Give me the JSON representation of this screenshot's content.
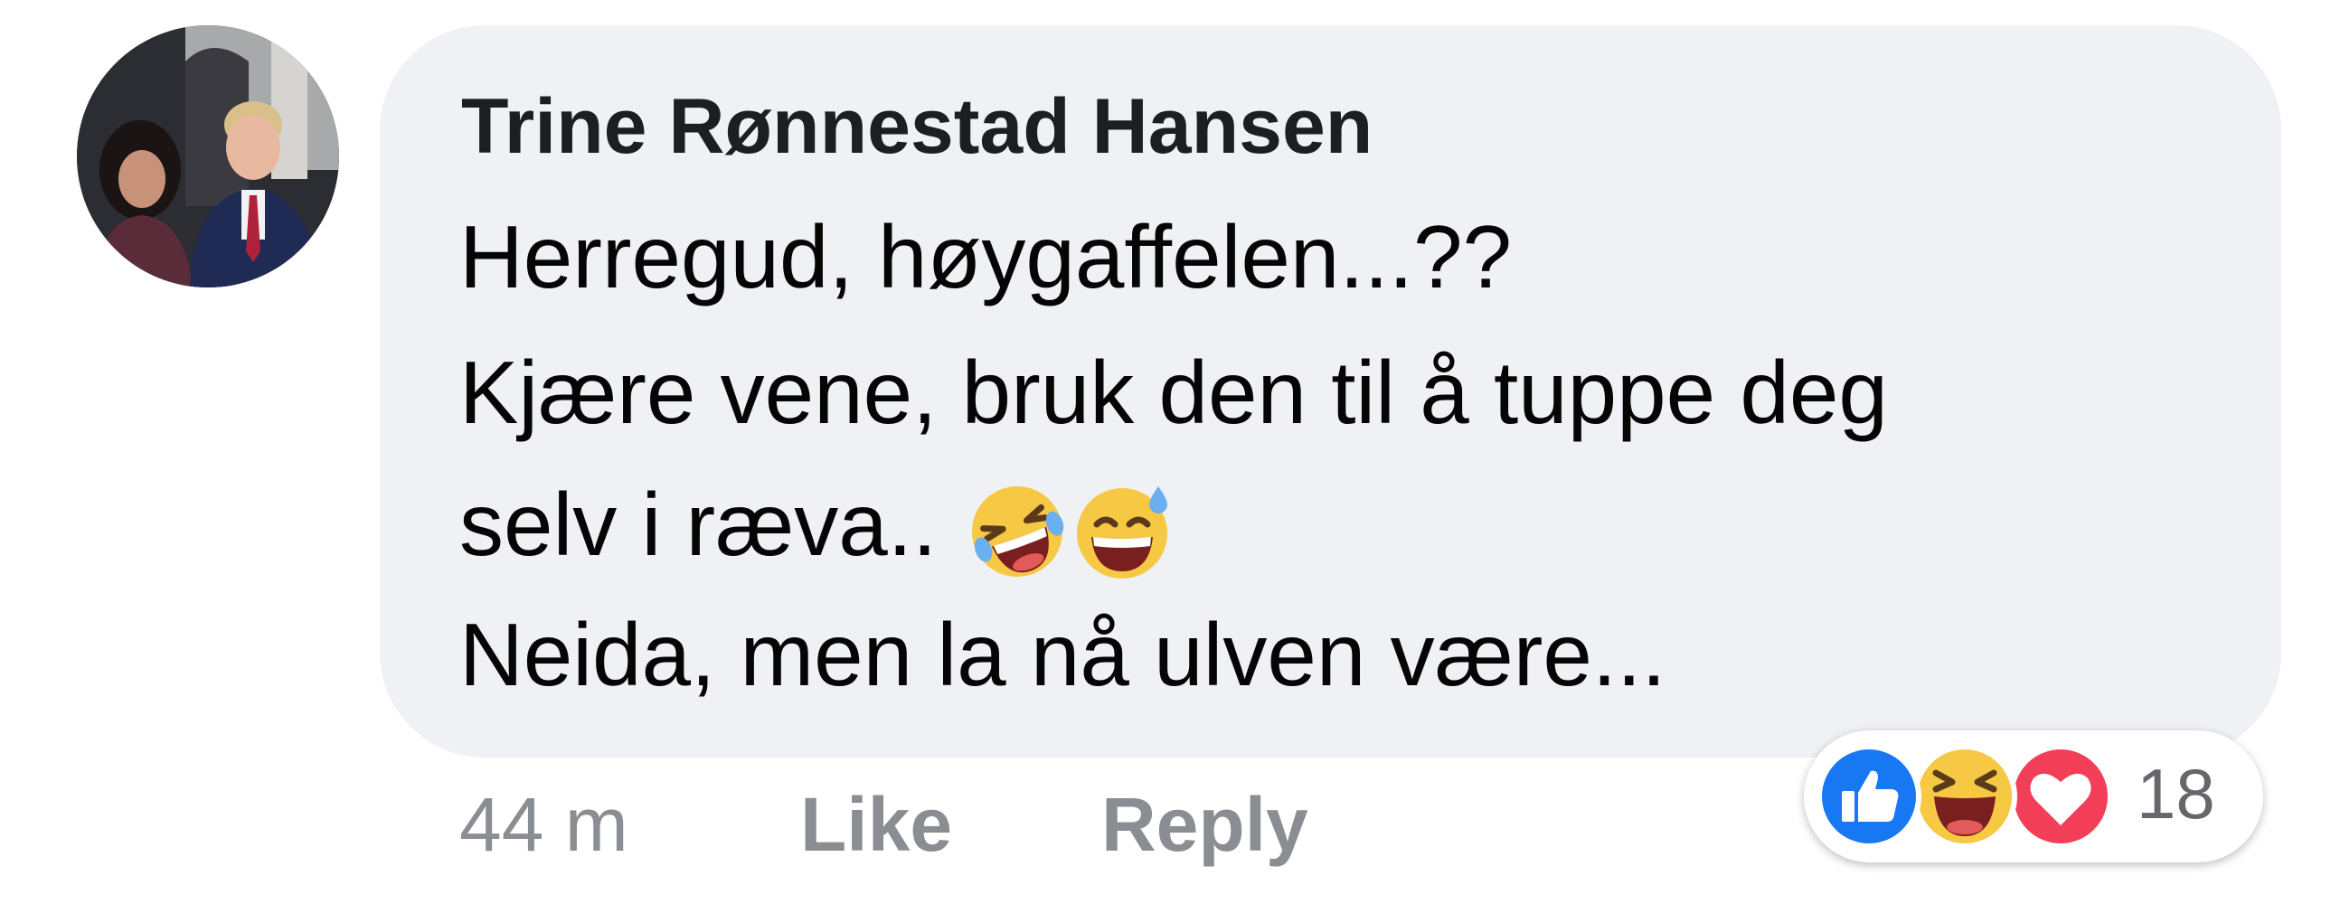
{
  "comment": {
    "author": "Trine Rønnestad Hansen",
    "lines": [
      "Herregud, høygaffelen...??",
      "Kjære vene, bruk den til å tuppe deg",
      "selv i ræva..",
      "Neida, men la nå ulven være..."
    ],
    "inline_emojis": [
      "rolling-on-floor-laughing-emoji",
      "grinning-sweat-emoji"
    ],
    "time": "44 m",
    "like_label": "Like",
    "reply_label": "Reply",
    "reactions": {
      "types": [
        "like-reaction-icon",
        "haha-reaction-icon",
        "love-reaction-icon"
      ],
      "count": "18"
    }
  },
  "colors": {
    "bubble": "#eff1f4",
    "author_text": "#1c1e21",
    "body_text": "#050505",
    "meta_text": "#8a8d91",
    "like_blue": "#1877f2",
    "love_red": "#f33e58",
    "haha_yellow": "#f7c844"
  }
}
